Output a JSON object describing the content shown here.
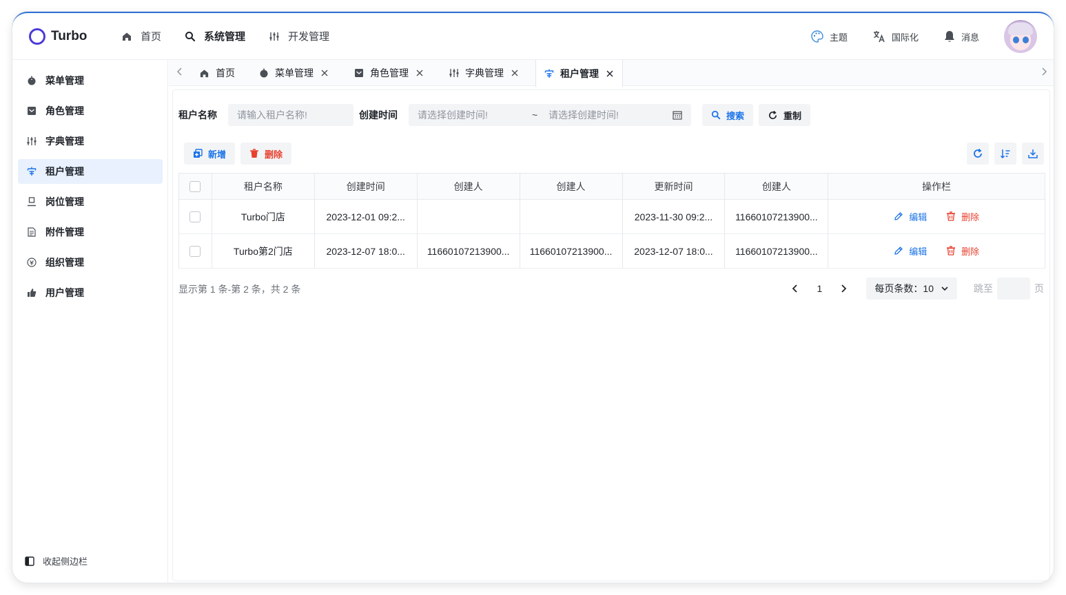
{
  "app": {
    "logo_text": "Turbo"
  },
  "topnav": [
    {
      "label": "首页",
      "icon": "home-icon"
    },
    {
      "label": "系统管理",
      "icon": "search-icon"
    },
    {
      "label": "开发管理",
      "icon": "dev-icon"
    }
  ],
  "header_right": {
    "theme": "主题",
    "i18n": "国际化",
    "messages": "消息"
  },
  "sidebar": {
    "items": [
      {
        "label": "菜单管理",
        "icon": "menu-icon"
      },
      {
        "label": "角色管理",
        "icon": "role-icon"
      },
      {
        "label": "字典管理",
        "icon": "dict-icon"
      },
      {
        "label": "租户管理",
        "icon": "tenant-icon"
      },
      {
        "label": "岗位管理",
        "icon": "post-icon"
      },
      {
        "label": "附件管理",
        "icon": "file-icon"
      },
      {
        "label": "组织管理",
        "icon": "org-icon"
      },
      {
        "label": "用户管理",
        "icon": "user-icon"
      }
    ],
    "collapse_label": "收起侧边栏"
  },
  "tabs": [
    {
      "label": "首页"
    },
    {
      "label": "菜单管理"
    },
    {
      "label": "角色管理"
    },
    {
      "label": "字典管理"
    },
    {
      "label": "租户管理"
    }
  ],
  "filter": {
    "tenant_name_label": "租户名称",
    "tenant_name_placeholder": "请输入租户名称!",
    "create_time_label": "创建时间",
    "start_placeholder": "请选择创建时间!",
    "range_sep": "~",
    "end_placeholder": "请选择创建时间!",
    "search_label": "搜索",
    "reset_label": "重制"
  },
  "toolbar": {
    "add_label": "新增",
    "delete_label": "删除"
  },
  "table": {
    "headers": [
      "租户名称",
      "创建时间",
      "创建人",
      "创建人",
      "更新时间",
      "创建人",
      "操作栏"
    ],
    "rows": [
      [
        "Turbo门店",
        "2023-12-01 09:2...",
        "",
        "",
        "2023-11-30 09:2...",
        "11660107213900..."
      ],
      [
        "Turbo第2门店",
        "2023-12-07 18:0...",
        "11660107213900...",
        "11660107213900...",
        "2023-12-07 18:0...",
        "11660107213900..."
      ]
    ],
    "edit_label": "编辑",
    "delete_label": "删除"
  },
  "pagination": {
    "summary": "显示第 1 条-第 2 条，共 2 条",
    "current_page": "1",
    "page_size_label": "每页条数：",
    "page_size": "10",
    "jump_label": "跳至",
    "page_suffix": "页"
  },
  "colors": {
    "accent": "#1a73e8",
    "danger": "#e8402f",
    "logo": "#4b3bd6",
    "active_bg": "#e8f1fd"
  }
}
